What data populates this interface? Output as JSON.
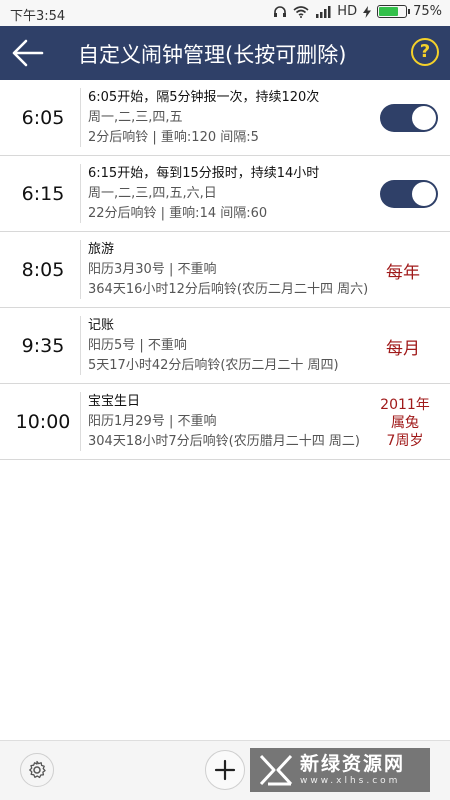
{
  "status_bar": {
    "time": "下午3:54",
    "network": "HD",
    "battery": "75%",
    "battery_level": 0.75
  },
  "app_bar": {
    "back_icon": "arrow-left-icon",
    "title": "自定义闹钟管理(长按可删除)",
    "help_label": "?"
  },
  "alarms": [
    {
      "time": "6:05",
      "line1": "6:05开始，隔5分钟报一次，持续120次",
      "line2": "周一,二,三,四,五",
      "line3": "2分后响铃 | 重响:120  间隔:5",
      "toggle_on": true
    },
    {
      "time": "6:15",
      "line1": "6:15开始，每到15分报时，持续14小时",
      "line2": "周一,二,三,四,五,六,日",
      "line3": "22分后响铃 | 重响:14  间隔:60",
      "toggle_on": true
    },
    {
      "time": "8:05",
      "line1": "旅游",
      "line2": "阳历3月30号 | 不重响",
      "line3": "364天16小时12分后响铃(农历二月二十四 周六)",
      "badge": "每年"
    },
    {
      "time": "9:35",
      "line1": "记账",
      "line2": "阳历5号 | 不重响",
      "line3": "5天17小时42分后响铃(农历二月二十 周四)",
      "badge": "每月"
    },
    {
      "time": "10:00",
      "line1": "宝宝生日",
      "line2": "阳历1月29号 | 不重响",
      "line3": "304天18小时7分后响铃(农历腊月二十四 周二)",
      "badge_lines": [
        "2011年",
        "属兔",
        "7周岁"
      ]
    }
  ],
  "bottom_bar": {
    "settings_icon": "gear-icon",
    "add_icon": "plus-icon"
  },
  "watermark": {
    "name": "新绿资源网",
    "url": "www.xlhs.com"
  },
  "colors": {
    "app_bar": "#2f4068",
    "help_accent": "#f4d12a",
    "badge_red": "#a01a1a",
    "toggle_on": "#2f4068"
  }
}
